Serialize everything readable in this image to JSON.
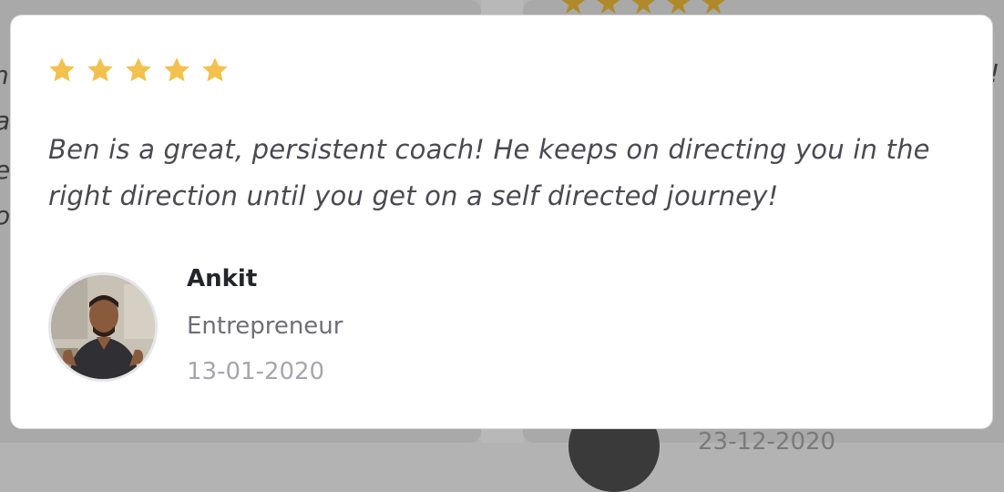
{
  "background": {
    "date_fragment": "23-12-2020"
  },
  "testimonial": {
    "rating": 5,
    "rating_max": 5,
    "star_color": "#f2c14e",
    "quote": "Ben is a great, persistent coach! He keeps on directing you in the right direction until you get on a self directed journey!",
    "author": {
      "name": "Ankit",
      "role": "Entrepreneur",
      "date": "13-01-2020",
      "avatar_icon": "person-photo"
    }
  }
}
